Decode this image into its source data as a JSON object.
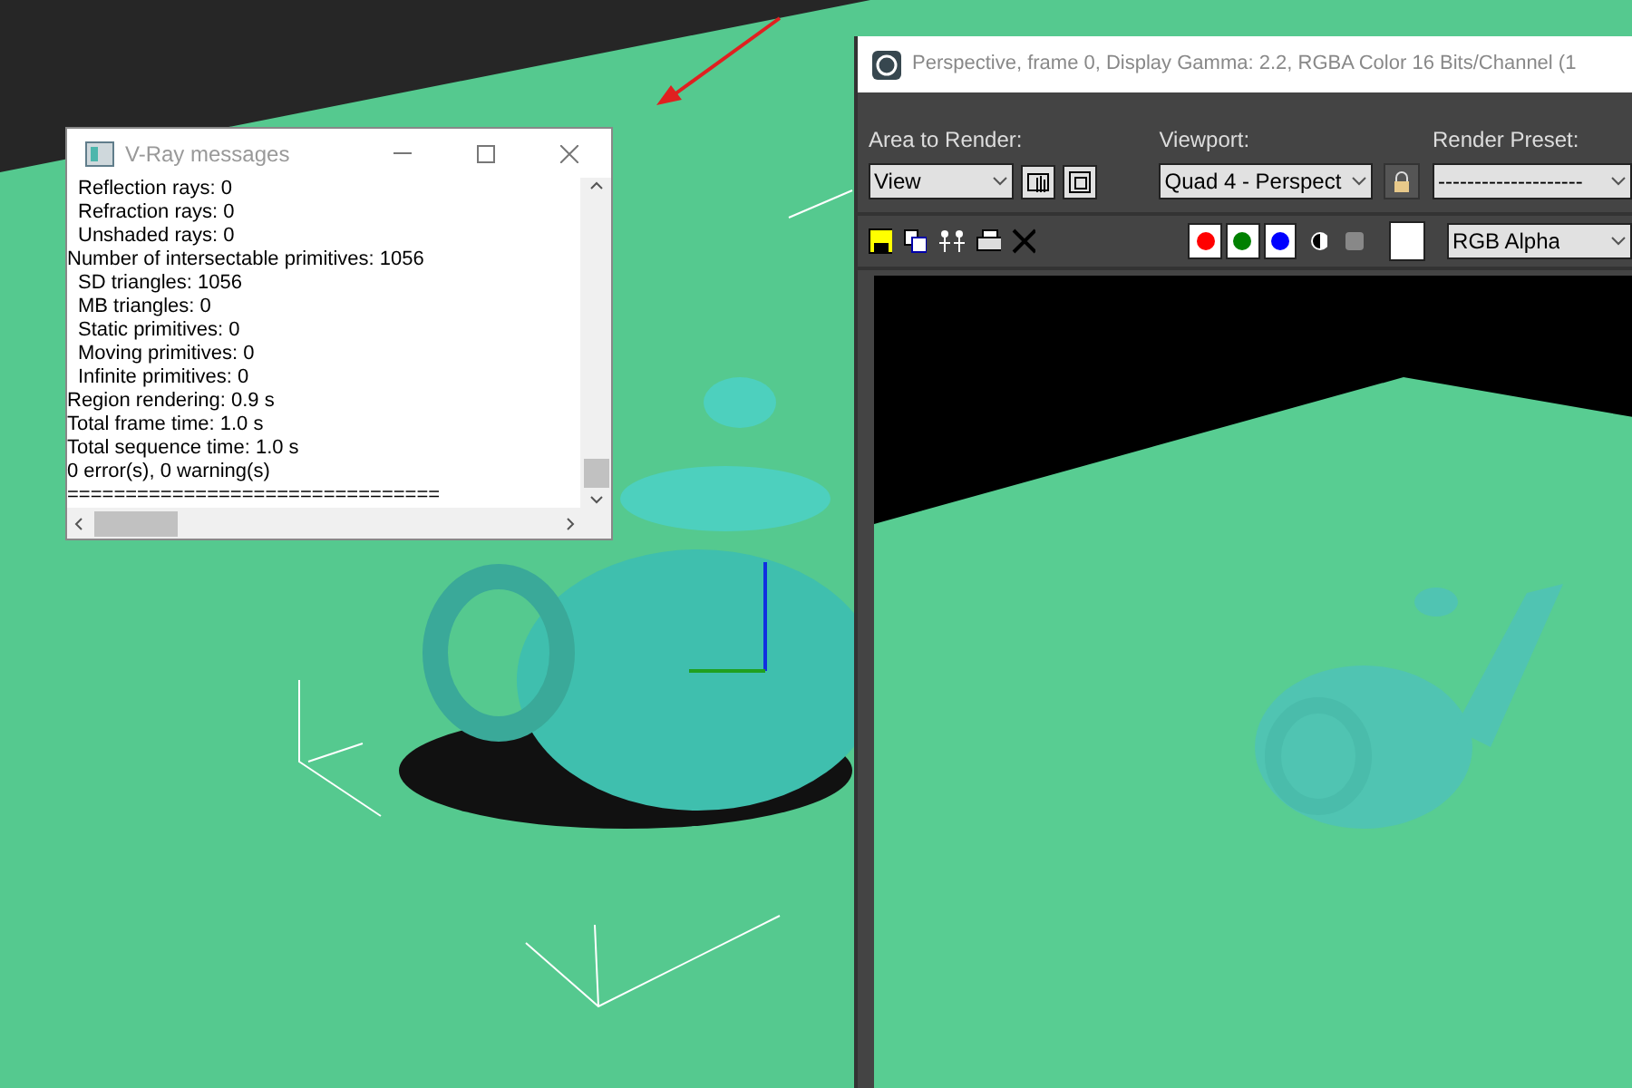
{
  "vray_window": {
    "title": "V-Ray messages",
    "lines": [
      {
        "kind": "detail",
        "text": "Reflection rays: 0"
      },
      {
        "kind": "detail",
        "text": "Refraction rays: 0"
      },
      {
        "kind": "detail",
        "text": "Unshaded rays: 0"
      },
      {
        "kind": "summary",
        "text": "Number of intersectable primitives: 1056"
      },
      {
        "kind": "detail",
        "text": "SD triangles: 1056"
      },
      {
        "kind": "detail",
        "text": "MB triangles: 0"
      },
      {
        "kind": "detail",
        "text": "Static primitives: 0"
      },
      {
        "kind": "detail",
        "text": "Moving primitives: 0"
      },
      {
        "kind": "detail",
        "text": "Infinite primitives: 0"
      },
      {
        "kind": "summary",
        "text": "Region rendering: 0.9 s"
      },
      {
        "kind": "summary",
        "text": "Total frame time: 1.0 s"
      },
      {
        "kind": "summary",
        "text": "Total sequence time: 1.0 s"
      },
      {
        "kind": "summary",
        "text": "0 error(s), 0 warning(s)"
      },
      {
        "kind": "summary",
        "text": "================================"
      }
    ]
  },
  "render_window": {
    "title": "Perspective, frame 0, Display Gamma: 2.2, RGBA Color 16 Bits/Channel (1",
    "area_to_render": {
      "label": "Area to Render:",
      "value": "View"
    },
    "viewport": {
      "label": "Viewport:",
      "value": "Quad 4 - Perspect"
    },
    "render_preset": {
      "label": "Render Preset:",
      "value": "--------------------"
    },
    "channels": [
      {
        "color": "#ff0000"
      },
      {
        "color": "#008000"
      },
      {
        "color": "#0000ff"
      }
    ],
    "display_channel": "RGB Alpha"
  }
}
